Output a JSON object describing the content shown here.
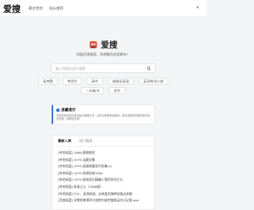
{
  "header": {
    "logo": "爱搜",
    "nav": [
      "最近更新",
      "站长推荐"
    ],
    "menu_icon": "close-icon"
  },
  "hero": {
    "title": "爱搜",
    "slogan": "网盘资源搜索，您想要的这里都有！"
  },
  "search": {
    "placeholder": "输入关键词进行搜索",
    "icon": "search-icon"
  },
  "tags": {
    "row1": [
      "高考题",
      "考研生",
      "高中",
      "新概念英语",
      "英语单词二册"
    ],
    "row2": [
      "一年级书",
      "初中"
    ]
  },
  "notice": {
    "title": "温馨提示",
    "text": "本站所有内容均来自各大网盘分享，请自行甄别资源真伪，若涉及侵权请联系我们及时处理，感谢您支持！"
  },
  "panel": {
    "tabs": [
      "最新入库",
      "热门搜索"
    ],
    "rows": [
      "[夸克网盘] 1988-赛博朋克",
      "[夸克网盘] 1979-宝藏全集",
      "[夸克网盘] 1979-英雄联盟系列合集(1)",
      "[夸克网盘] 1979-哥谭系统1984",
      "[夸克网盘] 1979-星球战记精编3-冒险系列大头",
      "[夸克网盘] 纸青之火（1988版）",
      "[夸克网盘] TVC、采用新盘，去新盘完美转轮备全新推",
      "[百度网盘] 冰雪经典第四大剧院内部完整版运作日记版.apk"
    ]
  },
  "colors": {
    "accent": "#3b78e7",
    "background": "#f4f5f7"
  }
}
